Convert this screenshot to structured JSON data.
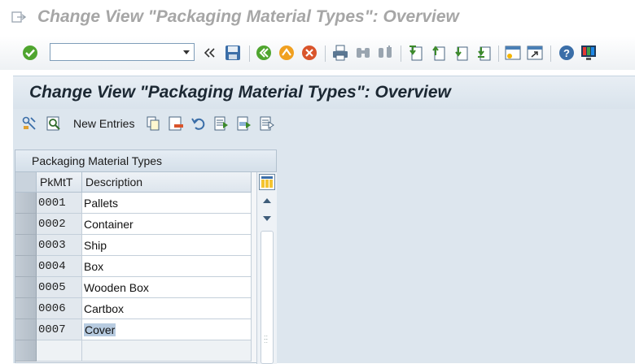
{
  "window": {
    "title": "Change View \"Packaging Material Types\": Overview"
  },
  "toolbar": {
    "command_field_value": "",
    "icons": [
      "enter-icon",
      "command-field",
      "more-icon",
      "save-icon",
      "back-icon",
      "exit-icon",
      "cancel-icon",
      "print-icon",
      "find-icon",
      "find-next-icon",
      "first-page-icon",
      "previous-page-icon",
      "next-page-icon",
      "last-page-icon",
      "new-session-icon",
      "shortcut-icon",
      "help-icon",
      "customize-layout-icon"
    ]
  },
  "screen": {
    "header": "Change View \"Packaging Material Types\": Overview"
  },
  "app_toolbar": {
    "new_entries_label": "New Entries",
    "icons": [
      "display-change-icon",
      "details-icon",
      "copy-as-icon",
      "delete-icon",
      "undo-icon",
      "select-all-icon",
      "select-block-icon",
      "deselect-all-icon"
    ]
  },
  "table": {
    "title": "Packaging Material Types",
    "columns": [
      "PkMtT",
      "Description"
    ],
    "rows": [
      {
        "key": "0001",
        "description": "Pallets"
      },
      {
        "key": "0002",
        "description": "Container"
      },
      {
        "key": "0003",
        "description": "Ship"
      },
      {
        "key": "0004",
        "description": "Box"
      },
      {
        "key": "0005",
        "description": "Wooden Box"
      },
      {
        "key": "0006",
        "description": "Cartbox"
      },
      {
        "key": "0007",
        "description": "Cover"
      }
    ]
  },
  "colors": {
    "title_text": "#a6a6a6",
    "header_bg": "#dde6ee",
    "selection_highlight": "#b7cbe0"
  }
}
